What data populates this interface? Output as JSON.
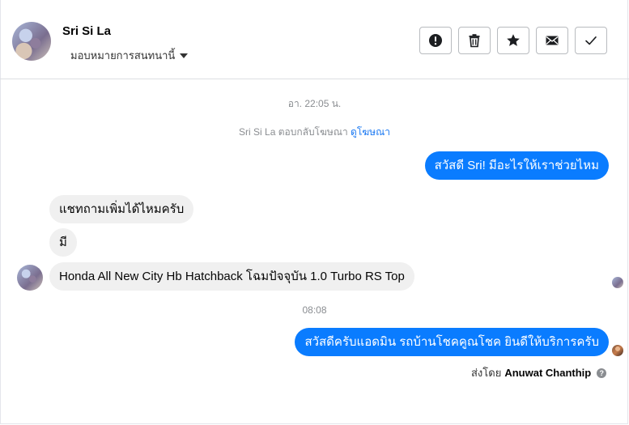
{
  "header": {
    "contact_name": "Sri Si La",
    "assign_label": "มอบหมายการสนทนานี้",
    "actions": [
      {
        "name": "spam-button",
        "icon": "exclamation-circle-icon"
      },
      {
        "name": "delete-button",
        "icon": "trash-icon"
      },
      {
        "name": "star-button",
        "icon": "star-icon"
      },
      {
        "name": "mark-unread-button",
        "icon": "envelope-icon"
      },
      {
        "name": "mark-done-button",
        "icon": "checkmark-icon"
      }
    ]
  },
  "thread": {
    "timestamp_1": "อา. 22:05 น.",
    "ad_reply_prefix": "Sri Si La ตอบกลับโฆษณา",
    "ad_link": "ดูโฆษณา",
    "msg_out_1": "สวัสดี Sri! มีอะไรให้เราช่วยไหม",
    "msg_in_1": "แชทถามเพิ่มได้ไหมครับ",
    "msg_in_2": "มี",
    "msg_in_3": "Honda All New City Hb Hatchback โฉมปัจจุบัน 1.0 Turbo RS Top",
    "timestamp_2": "08:08",
    "msg_out_2": "สวัสดีครับแอดมิน รถบ้านโชคคูณโชค ยินดีให้บริการครับ",
    "sent_by_prefix": "ส่งโดย",
    "sent_by_name": "Anuwat Chanthip",
    "help_glyph": "?"
  },
  "colors": {
    "outgoing_bubble": "#0a7cff",
    "incoming_bubble": "#f0f0f0",
    "link": "#1877f2"
  }
}
